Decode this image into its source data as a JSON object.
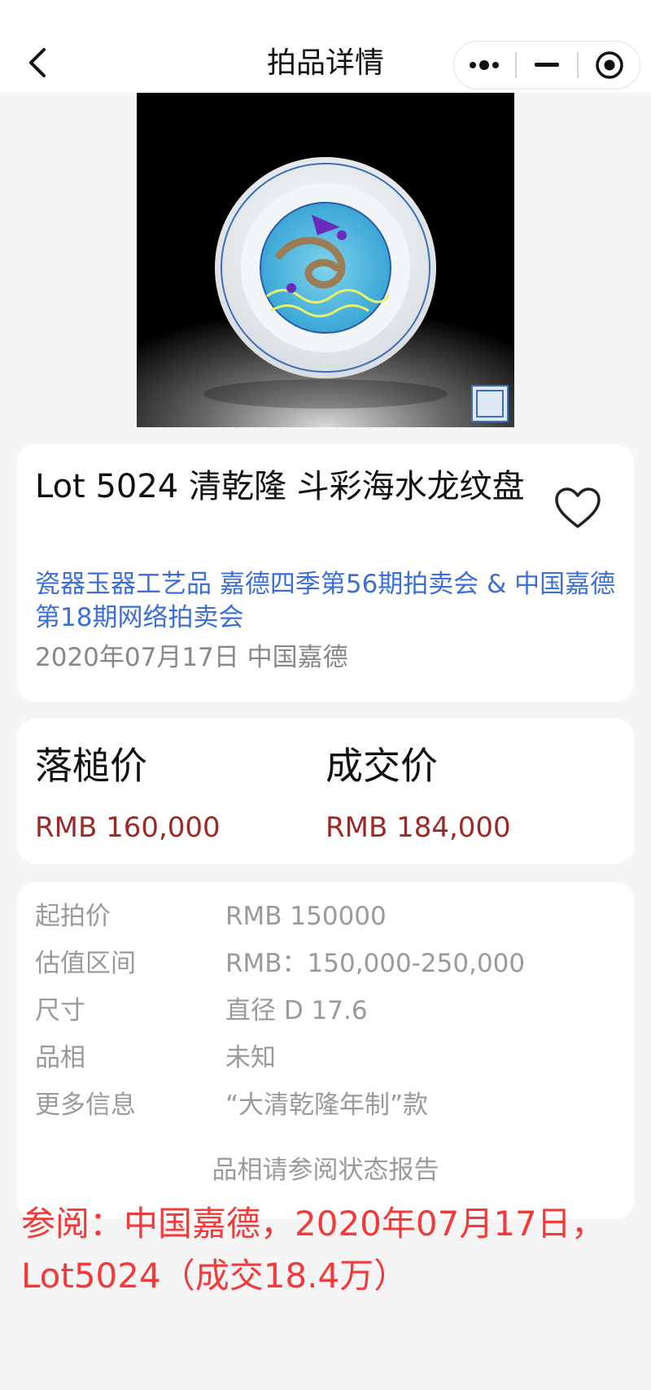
{
  "navbar": {
    "title": "拍品详情"
  },
  "lot": {
    "title": "Lot 5024 清乾隆 斗彩海水龙纹盘",
    "session": "瓷器玉器工艺品 嘉德四季第56期拍卖会 & 中国嘉德第18期网络拍卖会",
    "date_house": "2020年07月17日 中国嘉德"
  },
  "prices": {
    "hammer_label": "落槌价",
    "hammer_value": "RMB 160,000",
    "sold_label": "成交价",
    "sold_value": "RMB 184,000"
  },
  "details": {
    "rows": [
      {
        "label": "起拍价",
        "value": "RMB 150000"
      },
      {
        "label": "估值区间",
        "value": "RMB：150,000-250,000"
      },
      {
        "label": "尺寸",
        "value": "直径 D 17.6"
      },
      {
        "label": "品相",
        "value": "未知"
      },
      {
        "label": "更多信息",
        "value": "“大清乾隆年制”款"
      }
    ],
    "report_link": "品相请参阅状态报告"
  },
  "overlay_note": "参阅：中国嘉德，2020年07月17日，Lot5024（成交18.4万）",
  "colors": {
    "link": "#3c6fd6",
    "price": "#a12727",
    "note": "#f23a3a",
    "muted": "#9a9a9a"
  },
  "icons": [
    "chevron-left-icon",
    "more-dots-icon",
    "minimize-icon",
    "close-target-icon",
    "heart-icon"
  ]
}
